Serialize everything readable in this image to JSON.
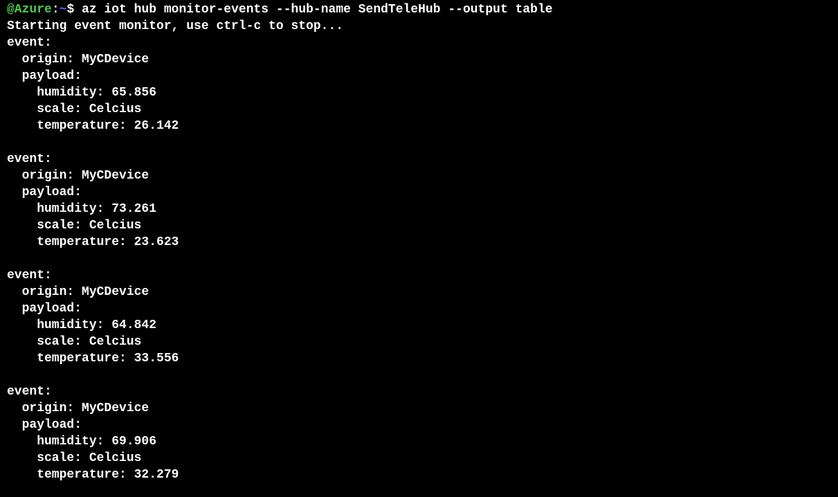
{
  "prompt": {
    "user_host": "@Azure",
    "separator": ":",
    "path": "~",
    "symbol": "$"
  },
  "command": "az iot hub monitor-events --hub-name SendTeleHub --output table",
  "start_message": "Starting event monitor, use ctrl-c to stop...",
  "labels": {
    "event": "event:",
    "origin": "origin:",
    "payload": "payload:",
    "humidity": "humidity:",
    "scale": "scale:",
    "temperature": "temperature:"
  },
  "events": [
    {
      "origin": "MyCDevice",
      "humidity": "65.856",
      "scale": "Celcius",
      "temperature": "26.142"
    },
    {
      "origin": "MyCDevice",
      "humidity": "73.261",
      "scale": "Celcius",
      "temperature": "23.623"
    },
    {
      "origin": "MyCDevice",
      "humidity": "64.842",
      "scale": "Celcius",
      "temperature": "33.556"
    },
    {
      "origin": "MyCDevice",
      "humidity": "69.906",
      "scale": "Celcius",
      "temperature": "32.279"
    }
  ]
}
